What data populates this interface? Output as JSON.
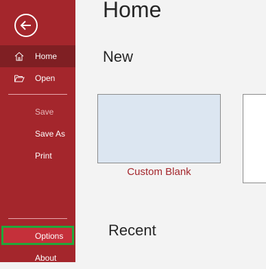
{
  "sidebar": {
    "back_icon": "back-arrow-icon",
    "items": [
      {
        "label": "Home",
        "icon": "home-icon",
        "state": "selected"
      },
      {
        "label": "Open",
        "icon": "folder-open-icon",
        "state": "normal"
      },
      {
        "label": "Save",
        "state": "disabled"
      },
      {
        "label": "Save As",
        "state": "normal"
      },
      {
        "label": "Print",
        "state": "normal"
      },
      {
        "label": "Options",
        "state": "highlighted"
      },
      {
        "label": "About",
        "state": "normal"
      }
    ]
  },
  "main": {
    "title": "Home",
    "new_section": "New",
    "templates": [
      {
        "label": "Custom Blank"
      }
    ],
    "recent_section": "Recent"
  },
  "colors": {
    "sidebar_bg": "#a4262c",
    "sidebar_selected": "#7f1f23",
    "highlight_border": "#21a83a",
    "accent_text": "#a4262c"
  }
}
